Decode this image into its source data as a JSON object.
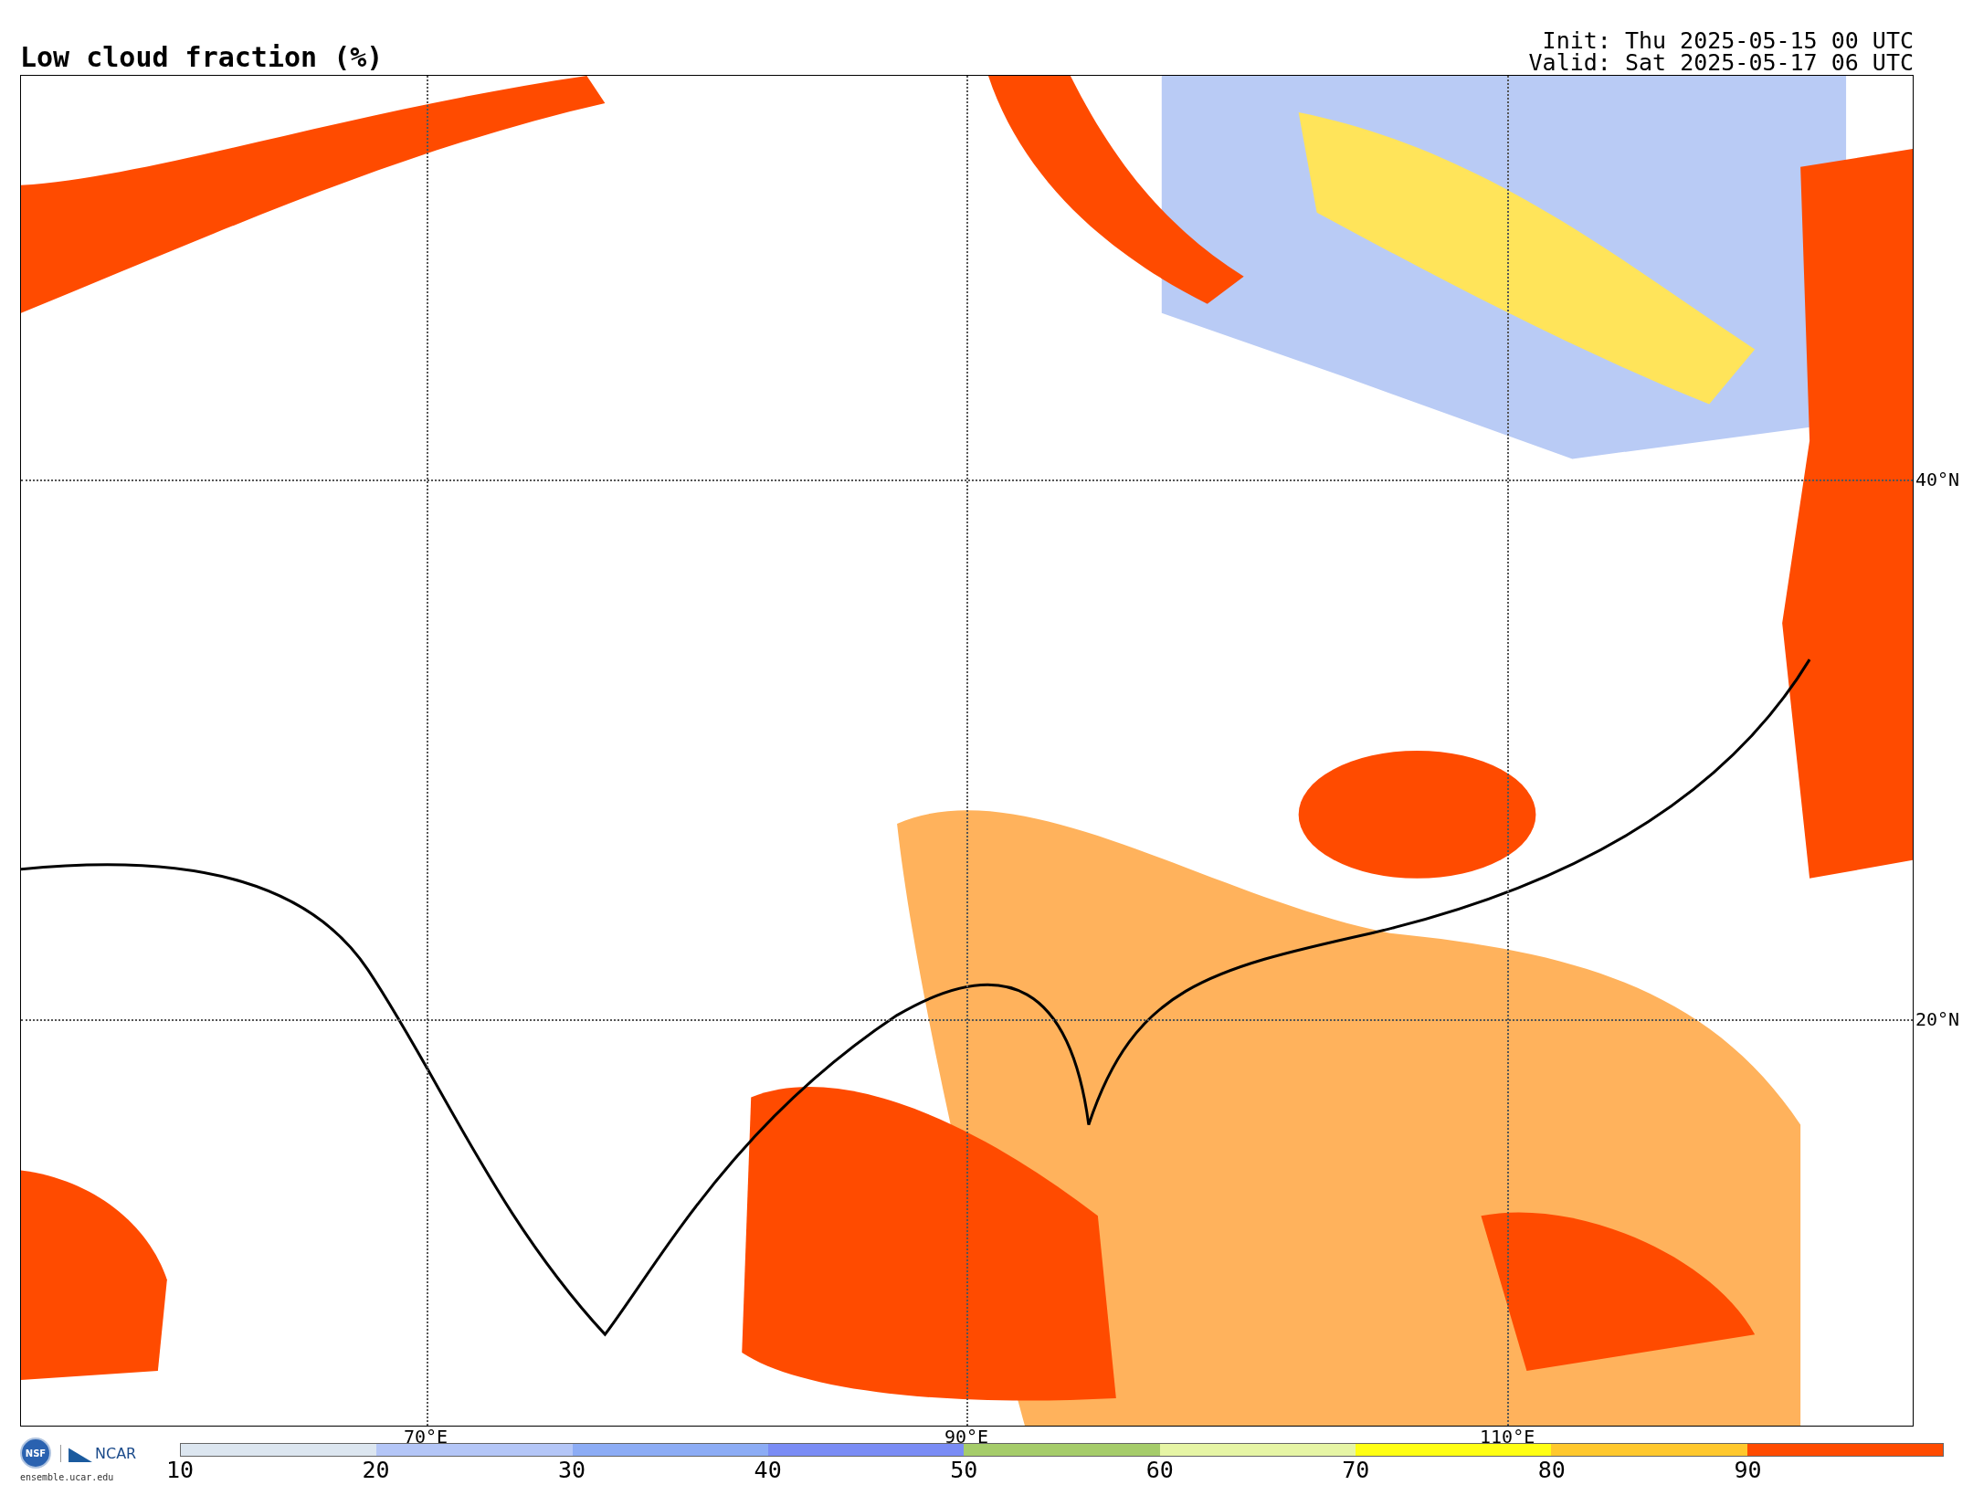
{
  "title": "Low cloud fraction (%)",
  "init": "Init: Thu 2025-05-15 00 UTC",
  "valid": "Valid: Sat 2025-05-17 06 UTC",
  "map": {
    "latitude_labels": [
      "40°N",
      "20°N"
    ],
    "longitude_labels": [
      "70°E",
      "90°E",
      "110°E"
    ]
  },
  "logos": {
    "nsf": "NSF",
    "ncar": "NCAR",
    "url": "ensemble.ucar.edu"
  },
  "colorbar": {
    "segments": [
      {
        "color": "#dce6f0"
      },
      {
        "color": "#b4c6f7"
      },
      {
        "color": "#8cacf5"
      },
      {
        "color": "#7a8cf5"
      },
      {
        "color": "#a5cc6a"
      },
      {
        "color": "#e6f5a5"
      },
      {
        "color": "#ffff14"
      },
      {
        "color": "#ffc82d"
      },
      {
        "color": "#ff4b00"
      }
    ],
    "labels": [
      "10",
      "20",
      "30",
      "40",
      "50",
      "60",
      "70",
      "80",
      "90"
    ]
  }
}
